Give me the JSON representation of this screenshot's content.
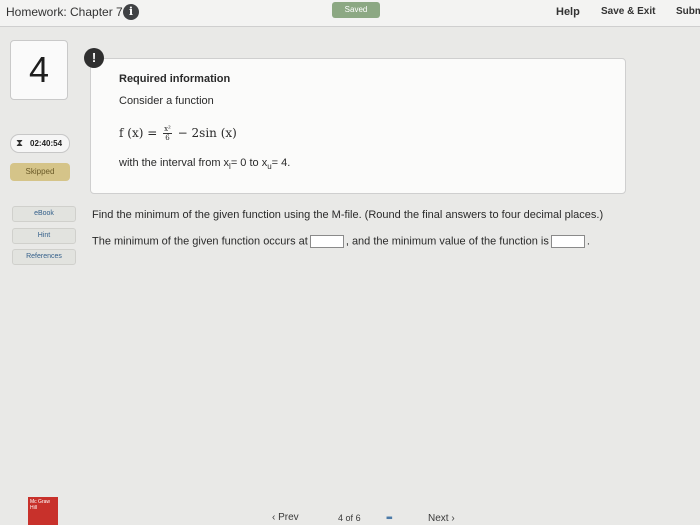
{
  "header": {
    "title": "Homework: Chapter 7",
    "info_icon": "i",
    "saved": "Saved",
    "help": "Help",
    "save_exit": "Save & Exit",
    "submit": "Subm"
  },
  "sidebar": {
    "question_number": "4",
    "timer": "02:40:54",
    "status": "Skipped",
    "ebook": "eBook",
    "hint": "Hint",
    "references": "References"
  },
  "required_info": {
    "alert": "!",
    "title": "Required information",
    "intro": "Consider a function",
    "formula_lhs": "f (x) = ",
    "frac_num": "x²",
    "frac_den": "6",
    "formula_rhs": " − 2sin (x)",
    "interval_prefix": "with the interval from x",
    "sub_l": "l",
    "eq_zero": "= 0 to x",
    "sub_u": "u",
    "eq_four": "= 4."
  },
  "question": {
    "text": "Find the minimum of the given function using the M-file. (Round the final answers to four decimal places.)",
    "answer_part1": "The minimum of the given function occurs at",
    "answer_part2": ", and the minimum value of the function is",
    "answer_end": ".",
    "input1_value": "",
    "input2_value": ""
  },
  "footer": {
    "logo": "Mc Graw Hill",
    "prev": "‹ Prev",
    "page_current": "4",
    "page_of": "of",
    "page_total": "6",
    "grid_icon": "▪▪▪",
    "next": "Next ›"
  }
}
